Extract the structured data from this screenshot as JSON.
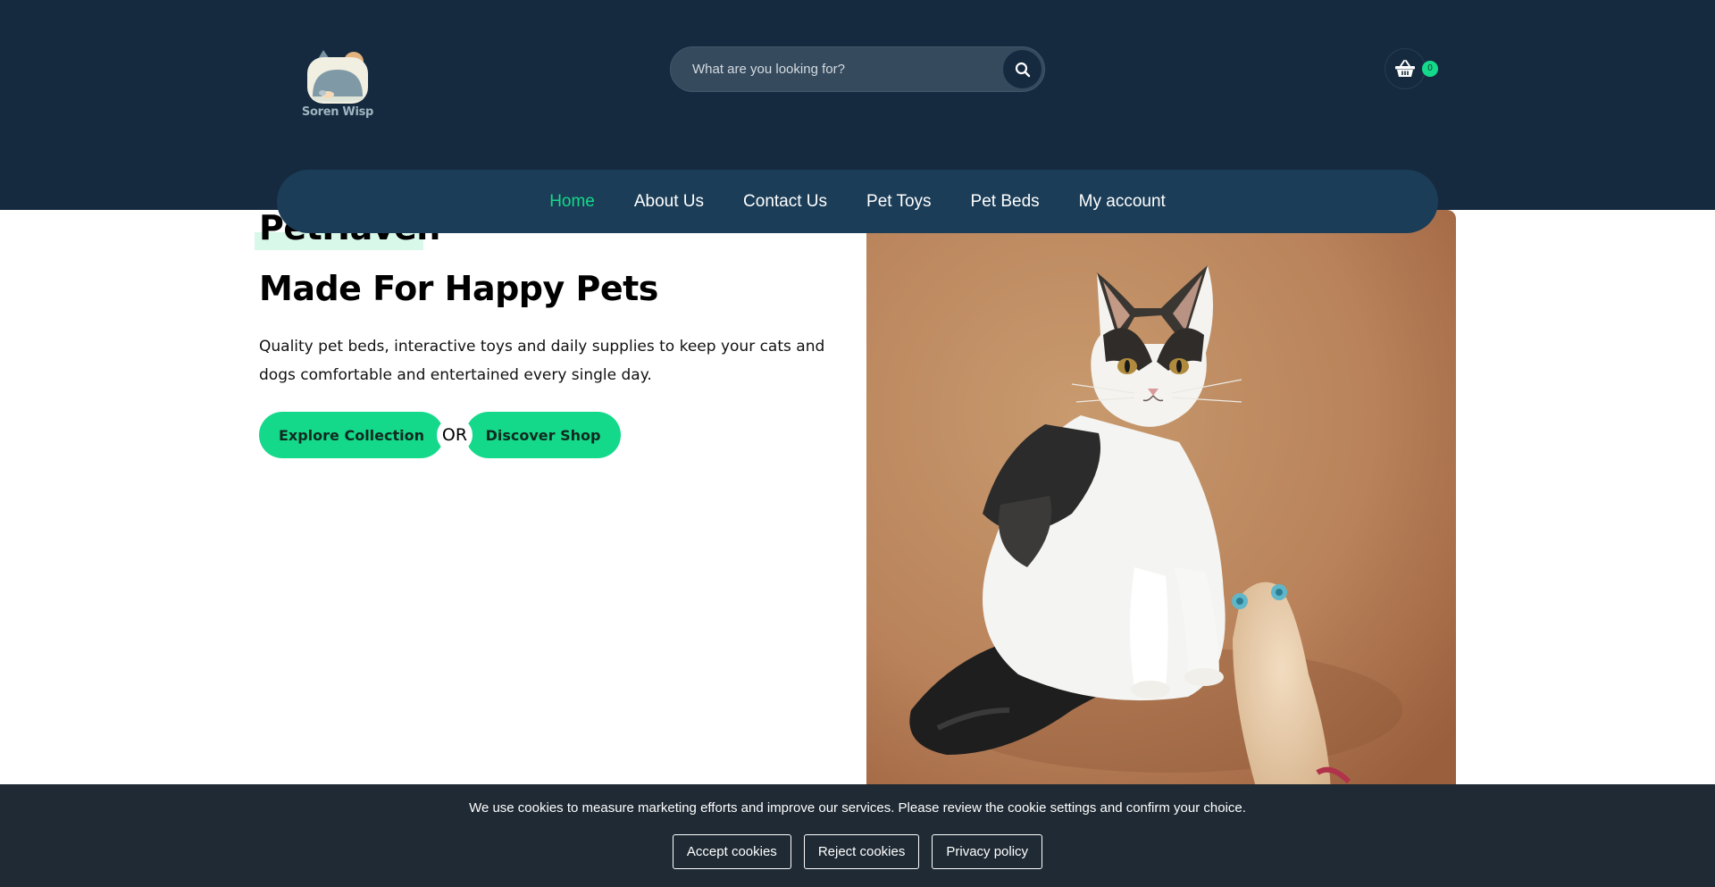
{
  "header": {
    "logo": {
      "text": "Soren Wisp"
    },
    "search": {
      "placeholder": "What are you looking for?",
      "button_icon": "search-icon"
    },
    "cart": {
      "icon": "basket-icon",
      "count": "0"
    }
  },
  "nav": {
    "items": [
      {
        "label": "Home",
        "active": true
      },
      {
        "label": "About Us"
      },
      {
        "label": "Contact Us"
      },
      {
        "label": "Pet Toys"
      },
      {
        "label": "Pet Beds"
      },
      {
        "label": "My account"
      }
    ]
  },
  "hero": {
    "brand": "PetHaven",
    "title": "Made For Happy Pets",
    "text": "Quality pet beds, interactive toys and daily supplies to keep your cats and dogs comfortable and entertained every single day.",
    "primary_button": "Explore Collection",
    "separator": "OR",
    "secondary_button": "Discover Shop"
  },
  "cookie": {
    "message": "We use cookies to measure marketing efforts and improve our services. Please review the cookie settings and confirm your choice.",
    "accept": "Accept cookies",
    "reject": "Reject cookies",
    "privacy": "Privacy policy"
  },
  "colors": {
    "header_bg": "#152a3f",
    "nav_bg": "#1b3d57",
    "accent": "#14d98a",
    "cookie_bg": "#1f2a34"
  }
}
